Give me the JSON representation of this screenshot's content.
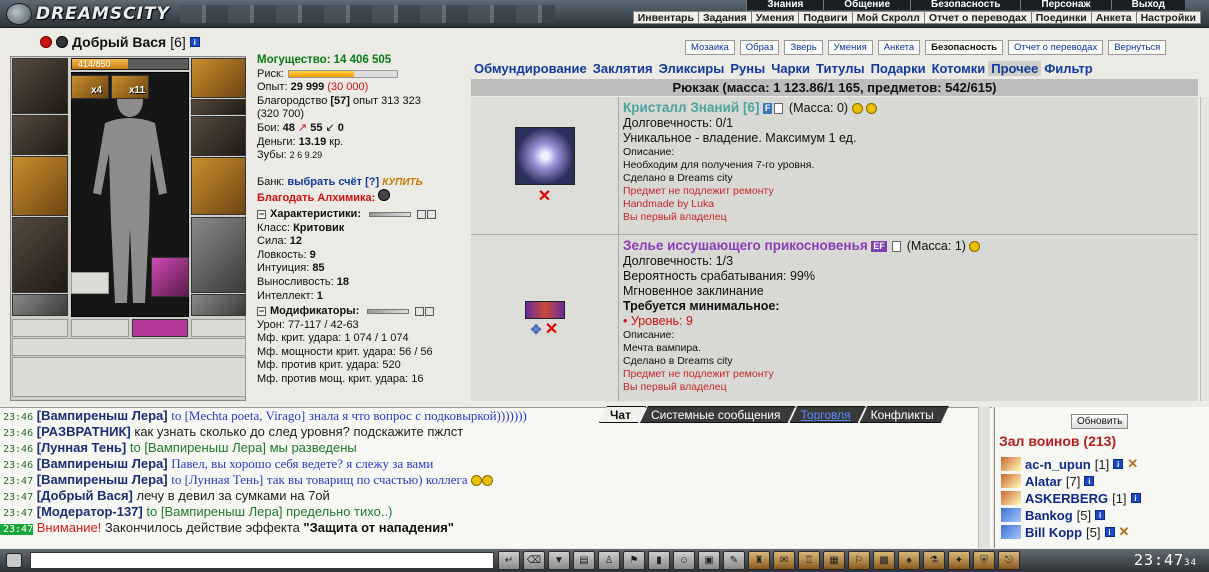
{
  "app": {
    "logo_text": "DREAMSCITY"
  },
  "top_menu_1": [
    "Знания",
    "Общение",
    "Безопасность",
    "Персонаж",
    "Выход"
  ],
  "top_menu_2": [
    "Инвентарь",
    "Задания",
    "Умения",
    "Подвиги",
    "Мой Скролл",
    "Отчет о переводах",
    "Поединки",
    "Анкета",
    "Настройки"
  ],
  "character": {
    "name": "Добрый Вася",
    "level": "[6]",
    "hp": "414/850",
    "hp_fraction": 0.487,
    "slot_counts": [
      "x4",
      "x11"
    ]
  },
  "stats": {
    "might_label": "Могущество:",
    "might_value": "14 406 505",
    "risk_label": "Риск:",
    "risk_fraction": 0.6,
    "exp_label": "Опыт:",
    "exp_value": "29 999",
    "exp_next": "(30 000)",
    "nobility_label": "Благородство",
    "nobility_value": "[57]",
    "nobility_exp": "опыт 313 323",
    "nobility_next": "(320 700)",
    "fights_label": "Бои:",
    "fights_win": "48",
    "fights_lose": "55",
    "fights_draw": "0",
    "money_label": "Деньги:",
    "money_value": "13.19",
    "money_unit": "кр.",
    "teeth_label": "Зубы:",
    "teeth_value": "2 6 9.29",
    "bank_label": "Банк:",
    "bank_link": "выбрать счёт",
    "bank_help": "[?]",
    "bank_buy": "КУПИТЬ",
    "bless_label": "Благодать Алхимика:",
    "chars_head": "Характеристики:",
    "class_label": "Класс:",
    "class_value": "Критовик",
    "str_label": "Сила:",
    "str_value": "12",
    "agi_label": "Ловкость:",
    "agi_value": "9",
    "int_label": "Интуиция:",
    "int_value": "85",
    "end_label": "Выносливость:",
    "end_value": "18",
    "intel_label": "Интеллект:",
    "intel_value": "1",
    "mods_head": "Модификаторы:",
    "dmg_label": "Урон:",
    "dmg_value": "77-117 / 42-63",
    "mf_crit_label": "Мф. крит. удара:",
    "mf_crit_value": "1 074 / 1 074",
    "mf_crit_pow_label": "Мф. мощности крит. удара:",
    "mf_crit_pow_value": "56 / 56",
    "mf_anticrit_label": "Мф. против крит. удара:",
    "mf_anticrit_value": "520",
    "mf_antipow_label": "Мф. против мощ. крит. удара:",
    "mf_antipow_value": "16"
  },
  "sub_buttons": [
    "Мозаика",
    "Образ",
    "Зверь",
    "Умения",
    "Анкета",
    "Безопасность",
    "Отчет о переводах",
    "Вернуться"
  ],
  "categories": [
    "Обмундирование",
    "Заклятия",
    "Эликсиры",
    "Руны",
    "Чарки",
    "Титулы",
    "Подарки",
    "Котомки",
    "Прочее",
    "Фильтр"
  ],
  "backpack_header": "Рюкзак (масса: 1 123.86/1 165, предметов: 542/615)",
  "items": [
    {
      "name": "Кристалл Знаний [6]",
      "tag": "F",
      "mass": "(Масса: 0)",
      "durability": "Долговечность: 0/1",
      "line2": "Уникальное - владение. Максимум 1 ед.",
      "desc_label": "Описание:",
      "desc": "Необходим для получения 7-го уровня.",
      "made": "Сделано в Dreams city",
      "red1": "Предмет не подлежит ремонту",
      "red2": "Handmade by Luka",
      "red3": "Вы первый владелец"
    },
    {
      "name": "Зелье иссушающего прикосновенья",
      "tag": "EF",
      "mass": "(Масса: 1)",
      "durability": "Долговечность: 1/3",
      "chance": "Вероятность срабатывания: 99%",
      "instant": "Мгновенное заклинание",
      "req_head": "Требуется минимальное:",
      "req_level": "• Уровень: 9",
      "desc_label": "Описание:",
      "desc": "Мечта вампира.",
      "made": "Сделано в Dreams city",
      "red1": "Предмет не подлежит ремонту",
      "red2": "Вы первый владелец"
    }
  ],
  "chat_tabs": [
    "Чат",
    "Системные сообщения",
    "Торговля",
    "Конфликты"
  ],
  "chat": [
    {
      "time": "23:46",
      "nick": "[Вампиреныш Лера]",
      "to": "to [Mechta poeta, Virago]",
      "msg": "знала я что вопрос с подковыркой)))))))",
      "style": "blue"
    },
    {
      "time": "23:46",
      "nick": "[РАЗВРАТНИК]",
      "to": "",
      "msg": "как узнать сколько до след уровня? подскажите пжлст",
      "style": "plain"
    },
    {
      "time": "23:46",
      "nick": "[Лунная Тень]",
      "to": "to [Вампиреныш Лера]",
      "msg": "мы разведены",
      "style": "to"
    },
    {
      "time": "23:46",
      "nick": "[Вампиреныш Лера]",
      "to": "",
      "msg": "Павел, вы хорошо себя ведете? я слежу за вами",
      "style": "blue"
    },
    {
      "time": "23:47",
      "nick": "[Вампиреныш Лера]",
      "to": "to [Лунная Тень]",
      "msg": "так вы товарищ по счастью) коллега",
      "style": "blue"
    },
    {
      "time": "23:47",
      "nick": "[Добрый Вася]",
      "to": "",
      "msg": "лечу в девил за сумками на 7ой",
      "style": "plain"
    },
    {
      "time": "23:47",
      "nick": "[Модератор-137]",
      "to": "to [Вампиреныш Лера]",
      "msg": "предельно тихо..)",
      "style": "to"
    }
  ],
  "chat_warning": {
    "time": "23:47",
    "label": "Внимание!",
    "text": "Закончилось действие эффекта",
    "effect": "\"Защита от нападения\""
  },
  "online": {
    "refresh": "Обновить",
    "hall": "Зал воинов (213)",
    "users": [
      {
        "name": "ac-n_upun",
        "level": "[1]"
      },
      {
        "name": "Alatar",
        "level": "[7]"
      },
      {
        "name": "ASKERBERG",
        "level": "[1]"
      },
      {
        "name": "Bankog",
        "level": "[5]"
      },
      {
        "name": "Bill Kopp",
        "level": "[5]"
      }
    ]
  },
  "clock": {
    "time": "23:47",
    "suffix": "34"
  },
  "colors": {
    "accent_blue": "#123a9e",
    "green": "#0a7a16",
    "red": "#d01010",
    "teal": "#4aa4a0",
    "purple": "#8e3bb8"
  }
}
